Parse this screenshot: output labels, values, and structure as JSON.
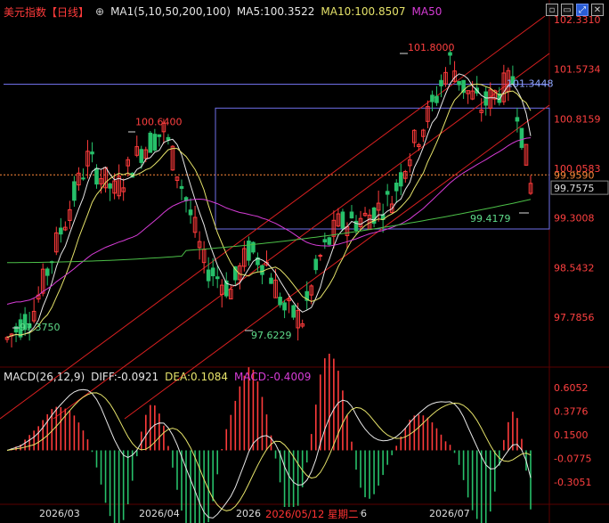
{
  "header": {
    "symbol": "美元指数【日线】",
    "indicator": "MA1(5,10,50,200,100)",
    "ma5": "MA5:100.3522",
    "ma10": "MA10:100.8507",
    "ma50": "MA50",
    "colors": {
      "symbol": "#ff3b3b",
      "indicator": "#e6e6e6",
      "ma5": "#e8e8e8",
      "ma10": "#e6e36a",
      "ma50": "#d63cd6"
    }
  },
  "window_controls": {
    "icons": [
      "restore-icon",
      "minimize-icon",
      "maximize-icon",
      "close-icon"
    ]
  },
  "price_axis": [
    "102.3310",
    "101.5734",
    "100.8159",
    "100.0583",
    "99.9590",
    "99.7575",
    "99.3008",
    "98.5432",
    "97.7856"
  ],
  "price_labels": {
    "high_label": "101.8000",
    "sub_high_label": "101.3448",
    "left_high": "100.6400",
    "low1": "97.3750",
    "low2": "97.6229",
    "recent_low": "99.4179"
  },
  "macd": {
    "title": "MACD(26,12,9)",
    "diff": "DIFF:-0.0921",
    "dea": "DEA:0.1084",
    "macd": "MACD:-0.4009",
    "axis": [
      "0.6052",
      "0.3776",
      "0.1500",
      "-0.0775",
      "-0.3051"
    ]
  },
  "x_axis": [
    "2026/03",
    "2026/04",
    "2026",
    "2026/05/12 星期二",
    "06",
    "2026/07"
  ],
  "chart_data": {
    "type": "line",
    "title": "美元指数【日线】",
    "ylim": [
      97.3,
      102.5
    ],
    "series_close_approx": [
      97.5,
      97.8,
      98.0,
      98.8,
      99.5,
      99.9,
      99.6,
      100.1,
      100.4,
      99.8,
      99.3,
      99.6,
      100.2,
      100.64,
      100.3,
      99.8,
      99.4,
      99.0,
      98.4,
      98.0,
      97.9,
      98.2,
      98.6,
      98.9,
      99.0,
      98.7,
      98.3,
      97.8,
      97.7,
      98.0,
      98.6,
      99.0,
      99.3,
      99.5,
      99.6,
      99.4,
      99.2,
      99.3,
      99.6,
      99.9,
      100.1,
      100.3,
      100.5,
      101.0,
      101.5,
      101.8,
      101.5,
      101.2,
      101.0,
      100.9,
      101.2,
      101.1,
      100.8,
      101.0,
      101.3,
      101.1,
      100.6,
      100.0,
      99.8
    ]
  },
  "colors": {
    "up": "#ff3b3b",
    "down": "#27c06a",
    "grid": "#2b0000",
    "ma5": "#e8e8e8",
    "ma10": "#e6e36a",
    "ma50": "#d63cd6",
    "ma100": "#4cc048",
    "channel": "#d92020",
    "box": "#6f6fe8"
  }
}
